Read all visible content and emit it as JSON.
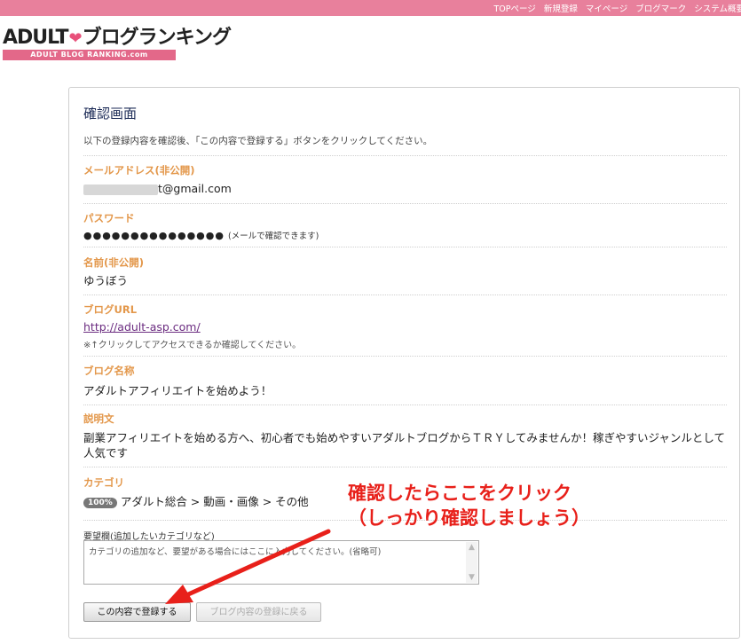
{
  "topnav": {
    "items": [
      "TOPページ",
      "新規登録",
      "マイページ",
      "ブログマーク",
      "システム概要"
    ]
  },
  "logo": {
    "main": "ADULT",
    "main2": "ブログランキング",
    "sub": "ADULT BLOG RANKING.com"
  },
  "page": {
    "title": "確認画面",
    "intro": "以下の登録内容を確認後、「この内容で登録する」ボタンをクリックしてください。"
  },
  "fields": {
    "email": {
      "label": "メールアドレス(非公開)",
      "value": "t@gmail.com"
    },
    "password": {
      "label": "パスワード",
      "value": "●●●●●●●●●●●●●●●",
      "note": "(メールで確認できます)"
    },
    "name": {
      "label": "名前(非公開)",
      "value": "ゆうぼう"
    },
    "blog_url": {
      "label": "ブログURL",
      "value": "http://adult-asp.com/",
      "note": "※↑クリックしてアクセスできるか確認してください。"
    },
    "blog_name": {
      "label": "ブログ名称",
      "value": "アダルトアフィリエイトを始めよう！"
    },
    "description": {
      "label": "説明文",
      "value": "副業アフィリエイトを始める方へ、初心者でも始めやすいアダルトブログからＴＲＹしてみませんか！稼ぎやすいジャンルとして人気です"
    },
    "category": {
      "label": "カテゴリ",
      "badge": "100%",
      "value": "アダルト総合 > 動画・画像 > その他"
    }
  },
  "request": {
    "label": "要望欄(追加したいカテゴリなど)",
    "placeholder": "カテゴリの追加など、要望がある場合にはここに入力してください。(省略可)"
  },
  "buttons": {
    "submit": "この内容で登録する",
    "back": "ブログ内容の登録に戻る"
  },
  "annotation": {
    "line1": "確認したらここをクリック",
    "line2": "（しっかり確認しましょう）",
    "color": "#e8201a"
  },
  "colors": {
    "topbar": "#e8809c",
    "label": "#e3974a",
    "title": "#1b2a56"
  }
}
